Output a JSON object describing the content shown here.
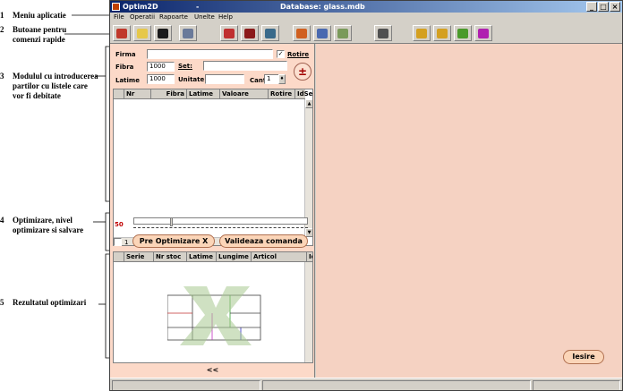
{
  "annotations": [
    {
      "num": "1",
      "text": "Meniu aplicatie"
    },
    {
      "num": "2",
      "text": "Butoane pentru comenzi rapide"
    },
    {
      "num": "3",
      "text": "Modulul cu introducerea partilor cu listele care vor fi debitate"
    },
    {
      "num": "4",
      "text": "Optimizare, nivel optimizare si salvare"
    },
    {
      "num": "5",
      "text": "Rezultatul optimizari"
    }
  ],
  "window": {
    "app_name": "Optim2D",
    "separator": "-",
    "database": "Database: glass.mdb",
    "controls": {
      "minimize": "_",
      "maximize": "□",
      "close": "×"
    }
  },
  "menu": [
    "File",
    "Operatii",
    "Rapoarte",
    "Unelte",
    "Help"
  ],
  "toolbar_buttons": [
    {
      "name": "new-order-icon",
      "color": "#c0392b"
    },
    {
      "name": "open-folder-icon",
      "color": "#e6c84a"
    },
    {
      "name": "save-icon",
      "color": "#1a1a1a"
    },
    {
      "name": "list-report-icon",
      "color": "#6a7a9a"
    },
    {
      "name": "cut-tool-icon",
      "color": "#c03030"
    },
    {
      "name": "gears-icon",
      "color": "#8b1a1a"
    },
    {
      "name": "user-icon",
      "color": "#3a6a8a"
    },
    {
      "name": "pie-chart-icon",
      "color": "#d06020"
    },
    {
      "name": "window-icon",
      "color": "#4a6ab0"
    },
    {
      "name": "multi-window-icon",
      "color": "#7a9a5a"
    },
    {
      "name": "calculator-icon",
      "color": "#505050"
    },
    {
      "name": "step-1-icon",
      "color": "#d4a020"
    },
    {
      "name": "step-2-icon",
      "color": "#d4a020"
    },
    {
      "name": "step-3-icon",
      "color": "#4a9a2a"
    },
    {
      "name": "bookmark-icon",
      "color": "#b020b0"
    }
  ],
  "form": {
    "firma_label": "Firma",
    "firma_value": "",
    "rotire_label": "Rotire",
    "rotire_checked": "✓",
    "fibra_label": "Fibra",
    "fibra_value": "1000",
    "set_label": "Set:",
    "set_value": "",
    "latime_label": "Latime",
    "latime_value": "1000",
    "unitate_label": "Unitate:",
    "unitate_value": "",
    "cant_label": "Cant",
    "cant_value": "1",
    "plus_minus": "±"
  },
  "parts_grid": {
    "columns": [
      "Nr",
      "Fibra",
      "Latime",
      "Valoare",
      "Rotire",
      "IdSe"
    ]
  },
  "optimize": {
    "level": "50",
    "checkbox_label": "1",
    "pre_button": "Pre Optimizare X",
    "validate_button": "Valideaza comanda"
  },
  "result_grid": {
    "columns": [
      "Serie",
      "Nr stoc",
      "Latime",
      "Lungime",
      "Articol",
      "Id"
    ]
  },
  "collapse_button": "<<",
  "exit_button": "Iesire",
  "colors": {
    "panel": "#fcd9c8",
    "right_area": "#f5d2c2",
    "title_start": "#0a246a",
    "level_text": "#c00000"
  }
}
